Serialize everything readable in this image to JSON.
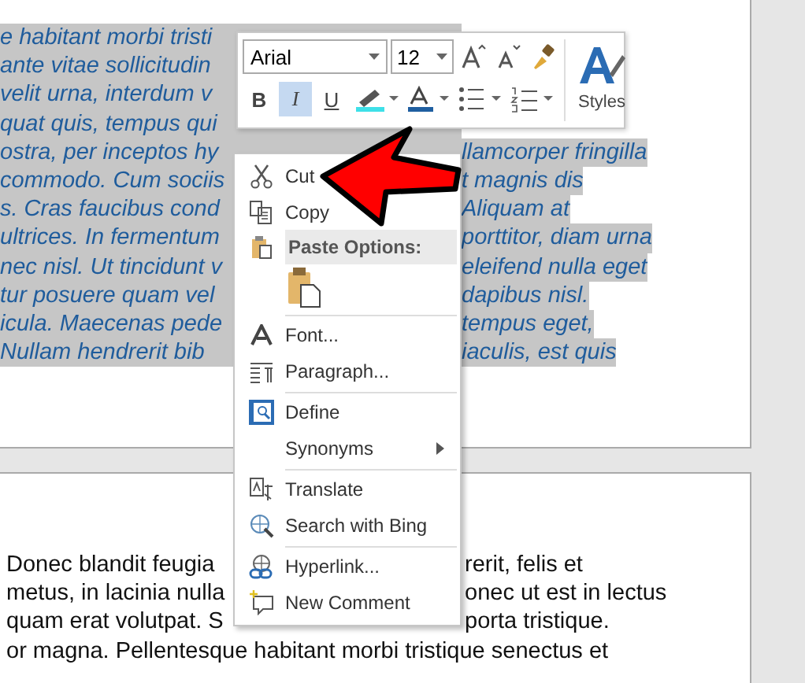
{
  "document": {
    "selected_lines": [
      {
        "left": "e habitant morbi tristi"
      },
      {
        "left": "ante vitae sollicitudin"
      },
      {
        "left": "velit urna, interdum v"
      },
      {
        "left": "quat quis, tempus qui"
      },
      {
        "left": "ostra, per inceptos hy",
        "right": "llamcorper fringilla"
      },
      {
        "left": "commodo. Cum sociis",
        "right": "t magnis dis"
      },
      {
        "left": "s. Cras faucibus cond",
        "right": "Aliquam at"
      },
      {
        "left": "ultrices. In fermentum",
        "right": "porttitor, diam urna"
      },
      {
        "left": "nec nisl. Ut tincidunt v",
        "right": "eleifend nulla eget"
      },
      {
        "left": "tur posuere quam vel",
        "right": "dapibus nisl."
      },
      {
        "left": "icula. Maecenas pede",
        "right": "tempus eget,"
      },
      {
        "left": "Nullam hendrerit bib",
        "right": "iaculis, est quis"
      }
    ],
    "next_page_lines": [
      {
        "left": "Donec blandit feugia",
        "right": "rerit, felis et"
      },
      {
        "left": "metus, in lacinia nulla",
        "right": "onec ut est in lectus"
      },
      {
        "left": "quam erat volutpat. S",
        "right": "porta tristique."
      },
      {
        "left": "or magna. Pellentesque habitant morbi tristique senectus et"
      }
    ]
  },
  "mini_toolbar": {
    "font": "Arial",
    "size": "12",
    "styles_label": "Styles",
    "buttons": [
      {
        "kind": "bold",
        "label": "B",
        "selected": false
      },
      {
        "kind": "italic",
        "label": "I",
        "selected": true
      },
      {
        "kind": "underline",
        "label": "U",
        "selected": false
      }
    ]
  },
  "context_menu": {
    "items": [
      {
        "kind": "item",
        "label": "Cut"
      },
      {
        "kind": "item",
        "label": "Copy"
      },
      {
        "kind": "header",
        "label": "Paste Options:"
      },
      {
        "kind": "paste"
      },
      {
        "kind": "separator"
      },
      {
        "kind": "item",
        "label": "Font..."
      },
      {
        "kind": "item",
        "label": "Paragraph..."
      },
      {
        "kind": "separator"
      },
      {
        "kind": "item",
        "label": "Define"
      },
      {
        "kind": "submenu",
        "label": "Synonyms"
      },
      {
        "kind": "separator"
      },
      {
        "kind": "item",
        "label": "Translate"
      },
      {
        "kind": "item",
        "label": "Search with Bing"
      },
      {
        "kind": "separator"
      },
      {
        "kind": "item",
        "label": "Hyperlink..."
      },
      {
        "kind": "item",
        "label": "New Comment"
      }
    ]
  }
}
